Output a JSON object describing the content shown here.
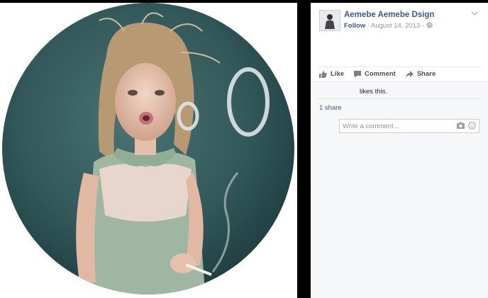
{
  "post": {
    "page_name": "Aemebe Aemebe Dsign",
    "follow_label": "Follow",
    "date": "August 14, 2013",
    "separator": "·",
    "audience_icon": "globe-icon",
    "options_icon": "chevron-down-icon"
  },
  "actions": {
    "like_label": "Like",
    "comment_label": "Comment",
    "share_label": "Share"
  },
  "feedback": {
    "likes_text": "likes this.",
    "shares_text": "1 share"
  },
  "comment": {
    "placeholder": "Write a comment...",
    "camera_icon": "camera-icon",
    "emoji_icon": "emoji-icon"
  },
  "colors": {
    "link_blue": "#3b5998",
    "meta_gray": "#90949c",
    "backdrop": "#000000",
    "photo_background": "#2f5457"
  }
}
